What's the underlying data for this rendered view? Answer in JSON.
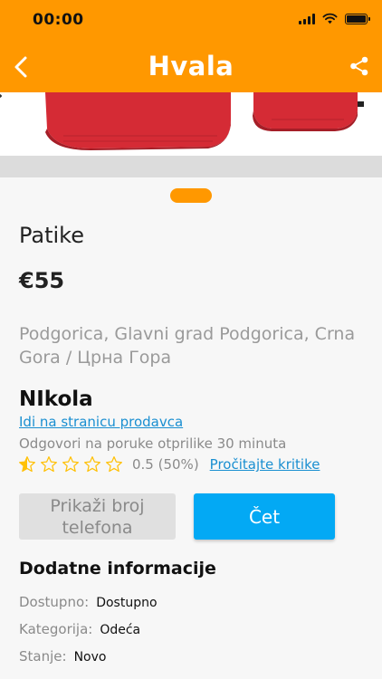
{
  "status_bar": {
    "time": "00:00"
  },
  "header": {
    "title": "Hvala",
    "background_color": "#FF9800"
  },
  "product": {
    "title": "Patike",
    "price": "€55",
    "location": "Podgorica, Glavni grad Podgorica, Crna Gora / Црна Гора"
  },
  "seller": {
    "name": "NIkola",
    "link_label": "Idi na stranicu prodavca",
    "response_time": "Odgovori na poruke otprilike 30 minuta",
    "rating_value": 0.5,
    "rating_text": "0.5 (50%)",
    "reviews_link": "Pročitajte kritike"
  },
  "actions": {
    "phone_label": "Prikaži broj telefona",
    "chat_label": "Čet",
    "chat_color": "#03A9F4"
  },
  "details": {
    "section_title": "Dodatne informacije",
    "rows": [
      {
        "label": "Dostupno:",
        "value": "Dostupno"
      },
      {
        "label": "Kategorija:",
        "value": "Odeća"
      },
      {
        "label": "Stanje:",
        "value": "Novo"
      }
    ]
  },
  "icons": {
    "back": "chevron-left-icon",
    "share": "share-icon",
    "star": "star-icon"
  }
}
